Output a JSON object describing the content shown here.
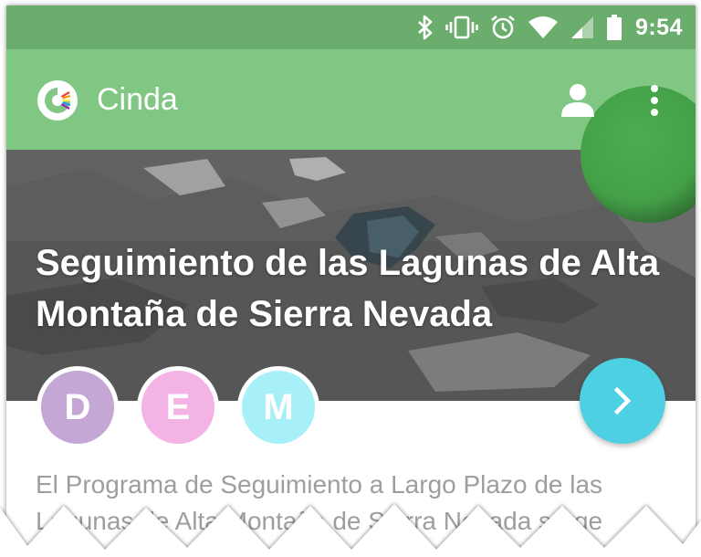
{
  "status_bar": {
    "time": "9:54",
    "icons": [
      "bluetooth-icon",
      "vibrate-icon",
      "alarm-icon",
      "wifi-icon",
      "signal-icon",
      "battery-icon"
    ]
  },
  "app_bar": {
    "title": "Cinda",
    "logo_icon": "cinda-logo-icon",
    "actions": [
      "profile-icon",
      "more-vert-icon"
    ]
  },
  "hero": {
    "title": "Seguimiento de las Lagunas de Alta Montaña de Sierra Nevada"
  },
  "badges": [
    {
      "letter": "D",
      "color": "#c5a7d6"
    },
    {
      "letter": "E",
      "color": "#f3b3e4"
    },
    {
      "letter": "M",
      "color": "#a8f0f8"
    }
  ],
  "next_button": {
    "icon": "chevron-right-icon",
    "color": "#4dd0e1"
  },
  "description": {
    "text": "El Programa de Seguimiento a Largo Plazo de las Lagunas de Alta Montaña de Sierra Nevada surge"
  },
  "colors": {
    "status_bar": "#6bad6d",
    "app_bar": "#81c784",
    "accent": "#4dd0e1",
    "description_text": "#9e9e9e"
  }
}
